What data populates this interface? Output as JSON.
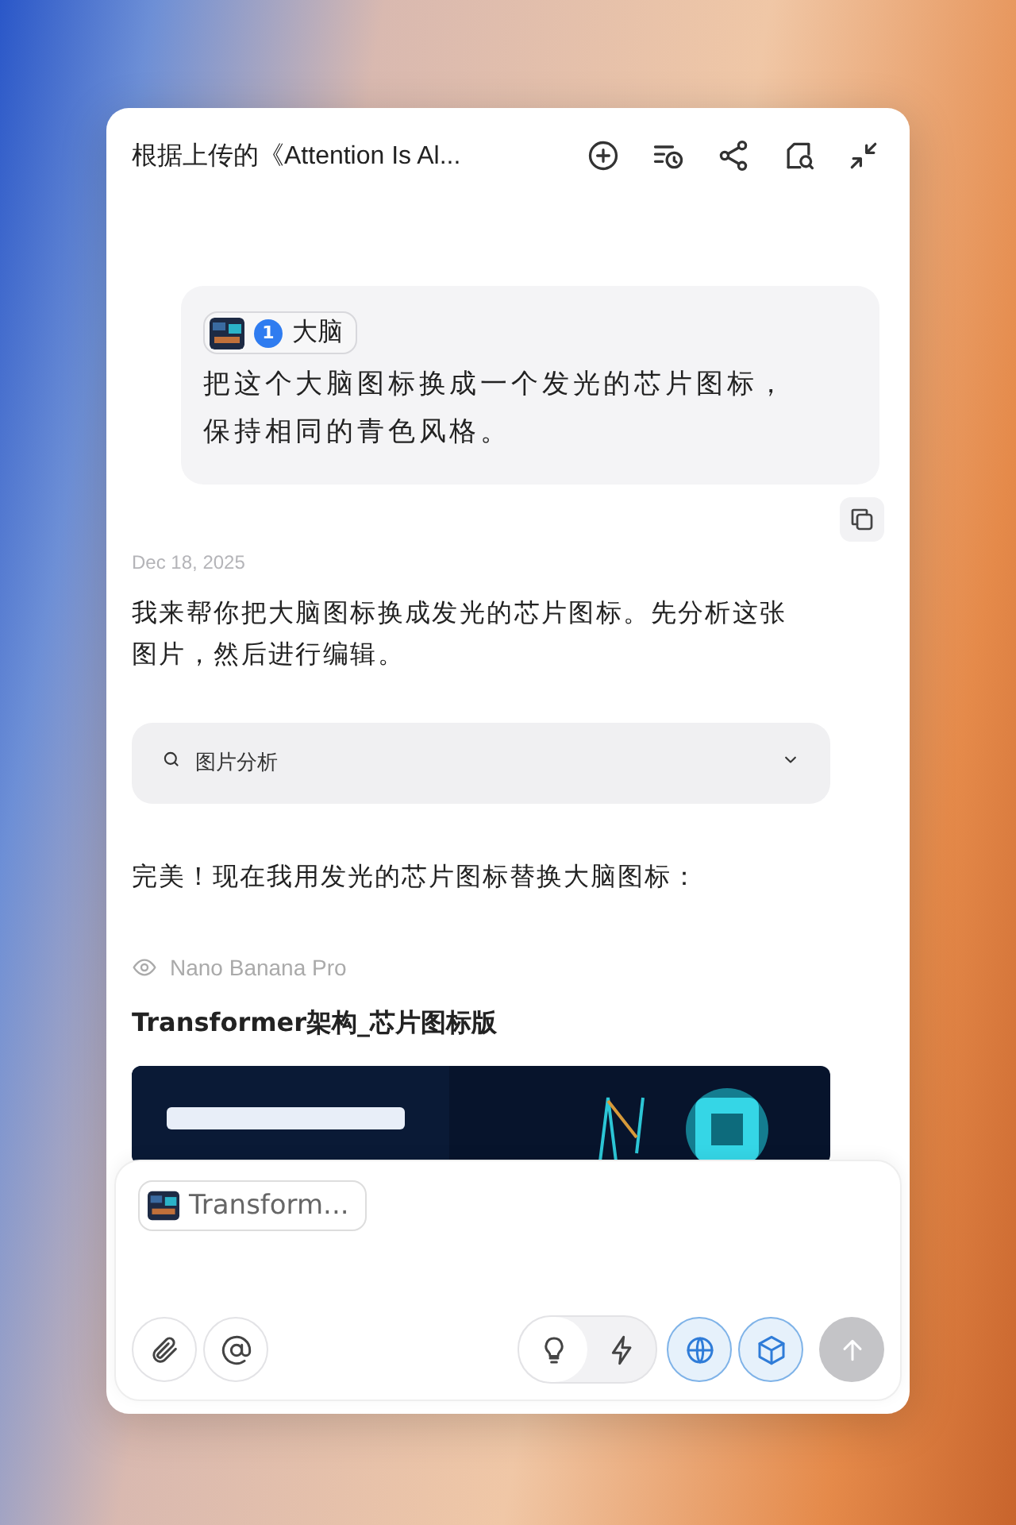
{
  "window": {
    "title": "根据上传的《Attention Is Al..."
  },
  "user_message": {
    "attachment": {
      "number": "1",
      "label": "大脑"
    },
    "text": "把这个大脑图标换成一个发光的芯片图标，保持相同的青色风格。"
  },
  "date": "Dec 18, 2025",
  "assistant": {
    "intro": "我来帮你把大脑图标换成发光的芯片图标。先分析这张图片，然后进行编辑。",
    "tool": {
      "label": "图片分析",
      "expanded": false
    },
    "followup": "完美！现在我用发光的芯片图标替换大脑图标：",
    "model": "Nano Banana Pro",
    "image_title": "Transformer架构_芯片图标版"
  },
  "composer": {
    "attachment": "Transform...",
    "modes": [
      {
        "kind": "think",
        "selected": true
      },
      {
        "kind": "fast",
        "selected": false
      }
    ],
    "toggles": [
      {
        "kind": "web",
        "on": true
      },
      {
        "kind": "cube",
        "on": true
      }
    ],
    "send": {
      "disabled": true
    }
  }
}
